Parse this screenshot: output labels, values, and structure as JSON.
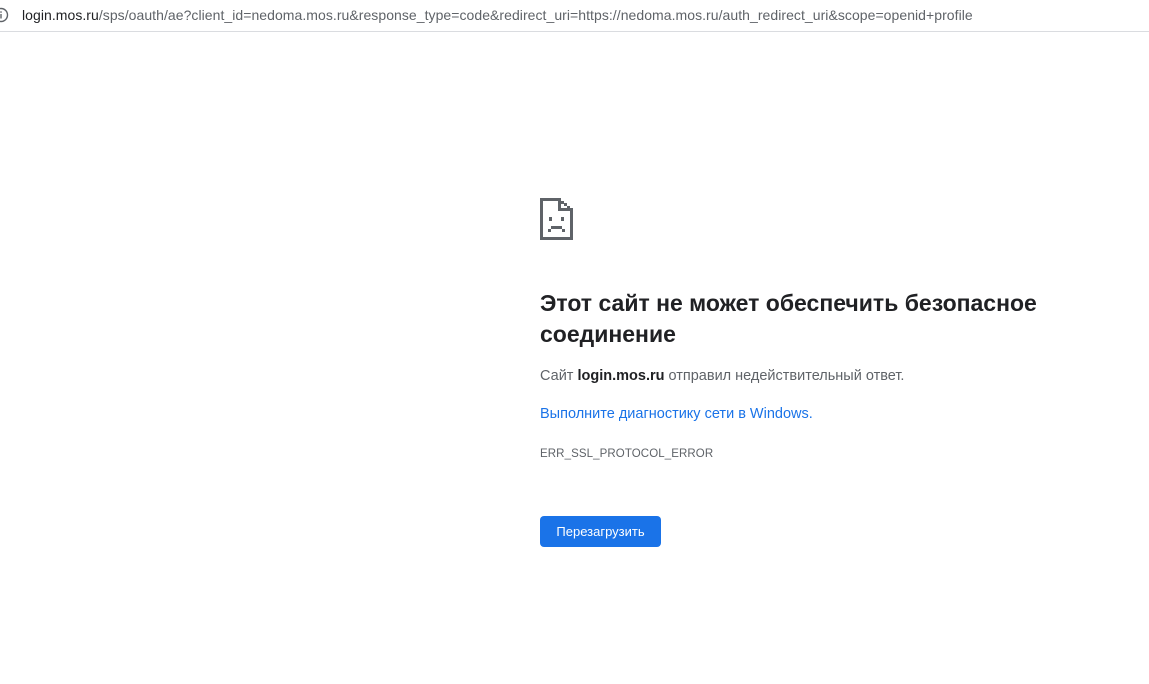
{
  "address_bar": {
    "icon": "info-icon",
    "url_host": "login.mos.ru",
    "url_rest": "/sps/oauth/ae?client_id=nedoma.mos.ru&response_type=code&redirect_uri=https://nedoma.mos.ru/auth_redirect_uri&scope=openid+profile"
  },
  "error_page": {
    "icon": "sad-page-icon",
    "heading": "Этот сайт не может обеспечить безопасное соединение",
    "desc_prefix": "Сайт ",
    "desc_host": "login.mos.ru",
    "desc_suffix": " отправил недействительный ответ.",
    "diagnostics_link": "Выполните диагностику сети в Windows.",
    "error_code": "ERR_SSL_PROTOCOL_ERROR",
    "reload_label": "Перезагрузить"
  },
  "colors": {
    "accent": "#1a73e8",
    "text_primary": "#202124",
    "text_secondary": "#5f6368"
  }
}
